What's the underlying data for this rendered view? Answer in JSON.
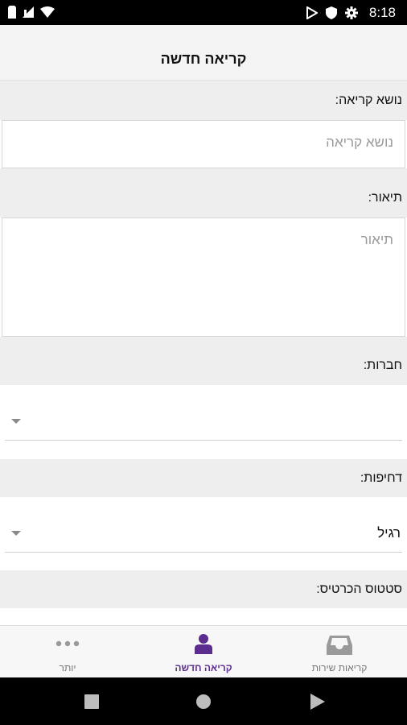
{
  "status_bar": {
    "time": "8:18"
  },
  "appbar": {
    "title": "קריאה חדשה"
  },
  "form": {
    "subject_label": "נושא קריאה:",
    "subject_placeholder": "נושא קריאה",
    "description_label": "תיאור:",
    "description_placeholder": "תיאור",
    "companies_label": "חברות:",
    "companies_value": "",
    "urgency_label": "דחיפות:",
    "urgency_value": "רגיל",
    "ticket_status_label": "סטטוס הכרטיס:"
  },
  "bottom_nav": {
    "items": [
      {
        "label": "קריאות שירות",
        "icon": "inbox-icon"
      },
      {
        "label": "קריאה חדשה",
        "icon": "person-icon"
      },
      {
        "label": "יותר",
        "icon": "more-dots-icon"
      }
    ],
    "active_color": "#5b2d8e"
  }
}
